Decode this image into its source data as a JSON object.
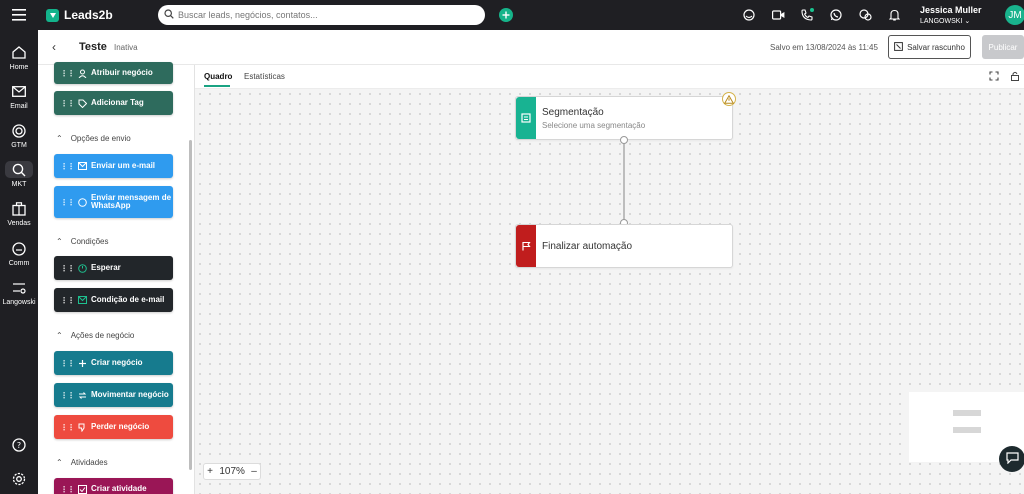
{
  "app": {
    "brand": "Leads2b"
  },
  "topbar": {
    "search_placeholder": "Buscar leads, negócios, contatos...",
    "icons": [
      "menu-icon",
      "headset-icon",
      "video-icon",
      "phone-icon",
      "whatsapp-icon",
      "integrations-icon",
      "bell-icon"
    ],
    "user": {
      "name": "Jessica Muller",
      "org": "LANGOWSKI",
      "initials": "JM"
    }
  },
  "rail": {
    "items": [
      {
        "label": "Home",
        "icon": "home-icon"
      },
      {
        "label": "Email",
        "icon": "mail-icon"
      },
      {
        "label": "GTM",
        "icon": "target-icon"
      },
      {
        "label": "MKT",
        "icon": "magnifier-icon",
        "active": true
      },
      {
        "label": "Vendas",
        "icon": "briefcase-icon"
      },
      {
        "label": "Comm",
        "icon": "chat-icon"
      },
      {
        "label": "Langowski",
        "icon": "settings-sliders-icon"
      }
    ],
    "bottom": [
      "help-icon",
      "gear-icon"
    ]
  },
  "header": {
    "title": "Teste",
    "status": "Inativa",
    "saved_text": "Salvo em 13/08/2024 às 11:45",
    "save_draft_label": "Salvar rascunho",
    "publish_label": "Publicar"
  },
  "panel": {
    "blocks_top": [
      {
        "label": "Atribuir negócio",
        "color": "#2e6b5d"
      },
      {
        "label": "Adicionar Tag",
        "color": "#2e6b5d"
      }
    ],
    "sections": [
      {
        "title": "Opções de envio",
        "items": [
          {
            "label": "Enviar um e-mail",
            "color": "#2f9bef"
          },
          {
            "label": "Enviar mensagem de WhatsApp",
            "color": "#2f9bef"
          }
        ]
      },
      {
        "title": "Condições",
        "items": [
          {
            "label": "Esperar",
            "color": "#22262a"
          },
          {
            "label": "Condição de e-mail",
            "color": "#22262a"
          }
        ]
      },
      {
        "title": "Ações de negócio",
        "items": [
          {
            "label": "Criar negócio",
            "color": "#167b8e"
          },
          {
            "label": "Movimentar negócio",
            "color": "#167b8e"
          },
          {
            "label": "Perder negócio",
            "color": "#ee4b3f"
          }
        ]
      },
      {
        "title": "Atividades",
        "items": [
          {
            "label": "Criar atividade",
            "color": "#9a1656"
          }
        ]
      }
    ]
  },
  "tabs": [
    {
      "label": "Quadro",
      "active": true
    },
    {
      "label": "Estatísticas",
      "active": false
    }
  ],
  "canvas": {
    "nodes": [
      {
        "title": "Segmentação",
        "subtitle": "Selecione uma segmentação",
        "color": "#18b392"
      },
      {
        "title": "Finalizar automação",
        "subtitle": "",
        "color": "#c01d1d"
      }
    ],
    "zoom": "107%"
  }
}
